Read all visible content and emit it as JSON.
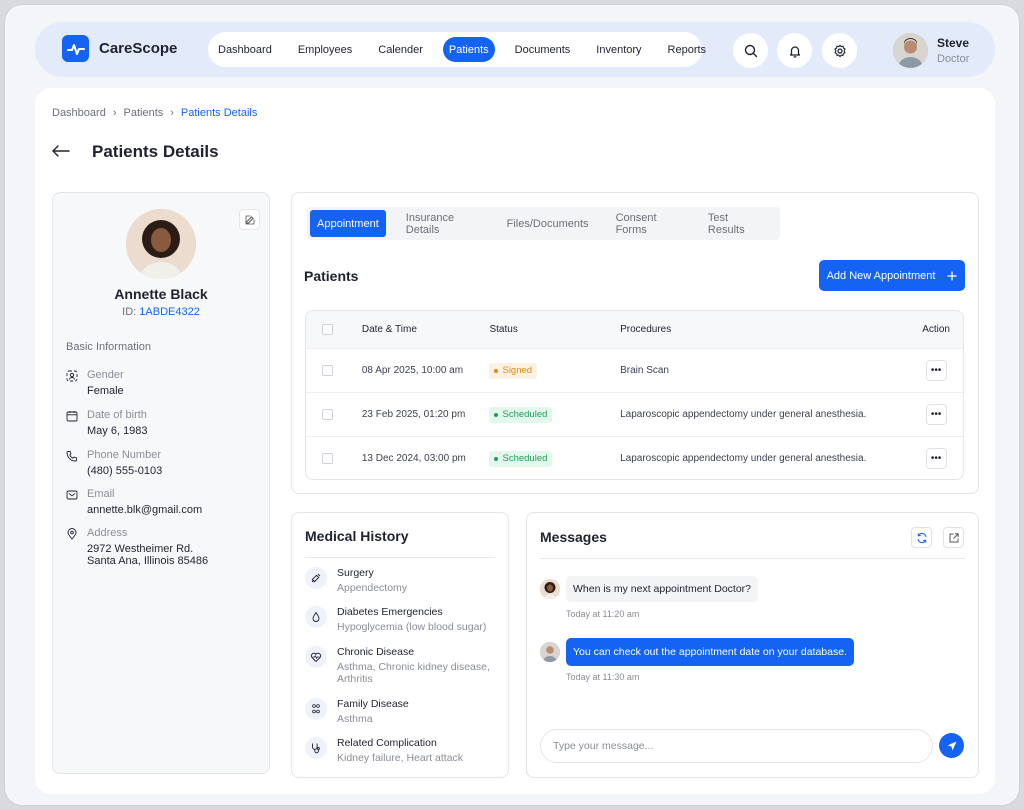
{
  "brand": {
    "name": "CareScope"
  },
  "nav": {
    "items": [
      "Dashboard",
      "Employees",
      "Calender",
      "Patients",
      "Documents",
      "Inventory",
      "Reports"
    ],
    "active": "Patients"
  },
  "icons": [
    "search-icon",
    "bell-icon",
    "gear-icon"
  ],
  "user": {
    "name": "Steve",
    "role": "Doctor"
  },
  "breadcrumb": {
    "items": [
      "Dashboard",
      "Patients",
      "Patients Details"
    ]
  },
  "page": {
    "title": "Patients Details"
  },
  "patient": {
    "name": "Annette Black",
    "id_label": "ID:",
    "id": "1ABDE4322",
    "section_title": "Basic Information",
    "fields": [
      {
        "icon": "gender-icon",
        "label": "Gender",
        "value": "Female"
      },
      {
        "icon": "calendar-icon",
        "label": "Date of birth",
        "value": "May 6, 1983"
      },
      {
        "icon": "phone-icon",
        "label": "Phone Number",
        "value": "(480) 555-0103"
      },
      {
        "icon": "mail-icon",
        "label": "Email",
        "value": "annette.blk@gmail.com"
      },
      {
        "icon": "location-pin-icon",
        "label": "Address",
        "value_lines": [
          "2972 Westheimer Rd.",
          "Santa Ana, Illinois 85486"
        ]
      }
    ]
  },
  "tabs": {
    "items": [
      "Appointment",
      "Insurance Details",
      "Files/Documents",
      "Consent Forms",
      "Test Results"
    ],
    "active": "Appointment"
  },
  "appointments": {
    "title": "Patients",
    "add_button": "Add New Appointment",
    "columns": [
      "Date & Time",
      "Status",
      "Procedures",
      "Action"
    ],
    "rows": [
      {
        "date": "08 Apr 2025, 10:00 am",
        "status": "Signed",
        "procedure": "Brain Scan",
        "action": "•••"
      },
      {
        "date": "23 Feb 2025, 01:20 pm",
        "status": "Scheduled",
        "procedure": "Laparoscopic appendectomy under general anesthesia.",
        "action": "•••"
      },
      {
        "date": "13 Dec 2024, 03:00 pm",
        "status": "Scheduled",
        "procedure": "Laparoscopic appendectomy under general anesthesia.",
        "action": "•••"
      }
    ]
  },
  "medical_history": {
    "title": "Medical History",
    "items": [
      {
        "icon": "syringe-icon",
        "name": "Surgery",
        "detail": "Appendectomy"
      },
      {
        "icon": "drop-icon",
        "name": "Diabetes Emergencies",
        "detail": "Hypoglycemia (low blood sugar)"
      },
      {
        "icon": "heart-pulse-icon",
        "name": "Chronic Disease",
        "detail": "Asthma, Chronic kidney disease, Arthritis"
      },
      {
        "icon": "family-icon",
        "name": "Family Disease",
        "detail": "Asthma"
      },
      {
        "icon": "stethoscope-icon",
        "name": "Related Complication",
        "detail": "Kidney failure, Heart attack"
      }
    ]
  },
  "messages": {
    "title": "Messages",
    "items": [
      {
        "from": "patient",
        "text": "When is my next appointment Doctor?",
        "time": "Today at 11:20 am"
      },
      {
        "from": "doctor",
        "text": "You can check out the appointment date on your database.",
        "time": "Today at 11:30 am"
      }
    ],
    "input_placeholder": "Type your message..."
  },
  "colors": {
    "accent": "#1463f3",
    "signed": "#e08a1e",
    "scheduled": "#1f9d57"
  }
}
